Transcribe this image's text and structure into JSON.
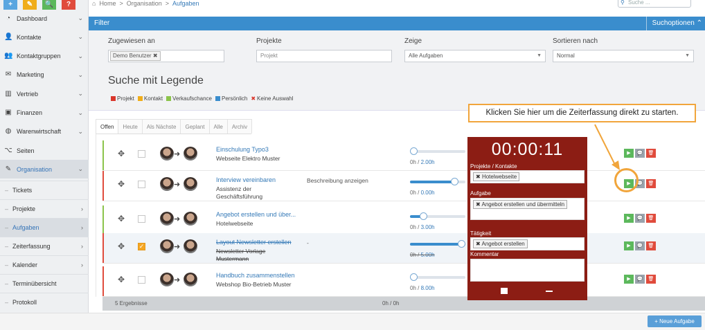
{
  "top_buttons": [
    {
      "glyph": "+",
      "color": "#5aa6e0"
    },
    {
      "glyph": "✎",
      "color": "#f0ad1a"
    },
    {
      "glyph": "🔍",
      "color": "#5cb85c"
    },
    {
      "glyph": "?",
      "color": "#e04b3c"
    }
  ],
  "sidebar": {
    "items": [
      {
        "label": "Dashboard",
        "icon": "dashboard-icon",
        "glyph": "◔"
      },
      {
        "label": "Kontakte",
        "icon": "user-icon",
        "glyph": "👤"
      },
      {
        "label": "Kontaktgruppen",
        "icon": "group-icon",
        "glyph": "👥"
      },
      {
        "label": "Marketing",
        "icon": "mail-icon",
        "glyph": "✉"
      },
      {
        "label": "Vertrieb",
        "icon": "chart-icon",
        "glyph": "▥"
      },
      {
        "label": "Finanzen",
        "icon": "money-icon",
        "glyph": "▣"
      },
      {
        "label": "Warenwirtschaft",
        "icon": "globe-icon",
        "glyph": "◍"
      },
      {
        "label": "Seiten",
        "icon": "sitemap-icon",
        "glyph": "⌥"
      },
      {
        "label": "Organisation",
        "icon": "edit-icon",
        "glyph": "✎"
      }
    ],
    "subitems": [
      {
        "label": "Tickets"
      },
      {
        "label": "Projekte"
      },
      {
        "label": "Aufgaben"
      },
      {
        "label": "Zeiterfassung"
      },
      {
        "label": "Kalender"
      },
      {
        "label": "Terminübersicht"
      },
      {
        "label": "Protokoll"
      }
    ]
  },
  "breadcrumb": {
    "home": "Home",
    "sep": ">",
    "level1": "Organisation",
    "current": "Aufgaben"
  },
  "search": {
    "placeholder": "Suche ..."
  },
  "filter": {
    "title": "Filter",
    "options_label": "Suchoptionen",
    "assigned_label": "Zugewiesen an",
    "assigned_value": "Demo Benutzer",
    "projects_label": "Projekte",
    "projects_placeholder": "Projekt",
    "show_label": "Zeige",
    "show_value": "Alle Aufgaben",
    "sort_label": "Sortieren nach",
    "sort_value": "Normal"
  },
  "legend": {
    "title": "Suche mit Legende",
    "items": [
      {
        "label": "Projekt",
        "color": "#d9362b"
      },
      {
        "label": "Kontakt",
        "color": "#f0ad1a"
      },
      {
        "label": "Verkaufschance",
        "color": "#8bc34a"
      },
      {
        "label": "Persönlich",
        "color": "#3a8dcd"
      },
      {
        "label": "Keine Auswahl",
        "color": "#d9362b"
      }
    ]
  },
  "tabs": [
    "Offen",
    "Heute",
    "Als Nächste",
    "Geplant",
    "Alle",
    "Archiv"
  ],
  "tasks": [
    {
      "title": "Einschulung Typo3",
      "sub": "Webseite Elektro Muster",
      "desc": "",
      "time": "0h / ",
      "time_link": "2.00h",
      "progress": 0,
      "done": false,
      "bar": "#8bc34a"
    },
    {
      "title": "Interview vereinbaren",
      "sub": "Assistenz der Geschäftsführung",
      "desc": "Beschreibung anzeigen",
      "time": "0h / ",
      "time_link": "0.00h",
      "progress": 0.85,
      "done": false,
      "bar": "#e04b3c"
    },
    {
      "title": "Angebot erstellen und über...",
      "sub": "Hotelwebseite",
      "desc": "",
      "time": "0h / ",
      "time_link": "3.00h",
      "progress": 0.2,
      "done": false,
      "bar": "#8bc34a"
    },
    {
      "title": "Layout Newsletter erstellen",
      "sub": "Newsletter Vorlage Mustermann",
      "desc": "-",
      "time": "0h / ",
      "time_link": "5.00h",
      "progress": 1,
      "done": true,
      "bar": "#e04b3c"
    },
    {
      "title": "Handbuch zusammenstellen",
      "sub": "Webshop Bio-Betrieb Muster",
      "desc": "",
      "time": "0h / ",
      "time_link": "8.00h",
      "progress": 0,
      "done": false,
      "bar": "#e04b3c"
    }
  ],
  "footer": {
    "count": "5 Ergebnisse",
    "total": "0h / 0h"
  },
  "new_task_label": "+ Neue Aufgabe",
  "timer": {
    "clock": "00:00:11",
    "project_label": "Projekte / Kontakte",
    "project_tag": "Hotelwebseite",
    "task_label": "Aufgabe",
    "task_tag": "Angebot erstellen und übermitteln",
    "activity_label": "Tätigkeit",
    "activity_tag": "Angebot erstellen",
    "comment_label": "Kommentar"
  },
  "callout": {
    "text": "Klicken Sie hier um die Zeiterfassung direkt zu starten."
  }
}
